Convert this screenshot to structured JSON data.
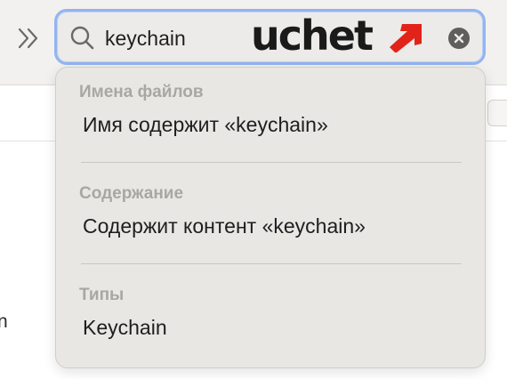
{
  "toolbar": {
    "overflow_icon": "double-chevron-right-icon"
  },
  "search": {
    "value": "keychain",
    "icon": "magnifying-glass-icon",
    "clear_icon": "clear-circle-x-icon"
  },
  "watermark": {
    "text": "uchet",
    "arrow_icon": "arrow-up-right-icon",
    "arrow_color": "#e2231a",
    "text_color": "#1a1a1a"
  },
  "background": {
    "edge_text": "n"
  },
  "dropdown": {
    "sections": [
      {
        "header": "Имена файлов",
        "item": "Имя содержит «keychain»"
      },
      {
        "header": "Содержание",
        "item": "Содержит контент «keychain»"
      },
      {
        "header": "Типы",
        "item": "Keychain"
      }
    ]
  },
  "colors": {
    "focus_ring": "#93b5f0",
    "dropdown_bg": "#e9e7e4",
    "section_header": "#a9a7a4"
  }
}
